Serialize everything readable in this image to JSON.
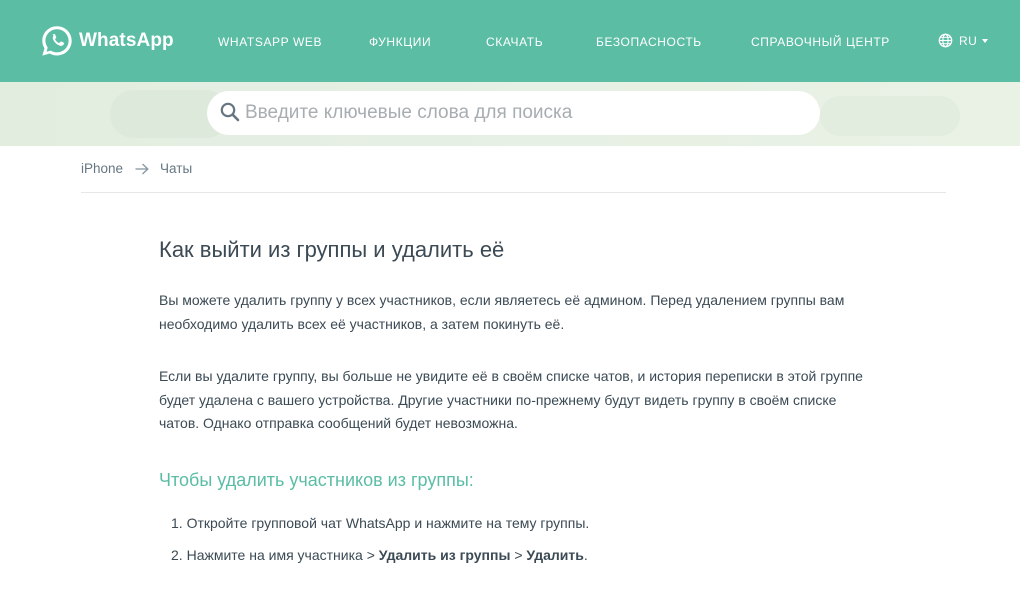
{
  "header": {
    "logo_text": "WhatsApp",
    "nav": [
      {
        "label": "WHATSAPP WEB"
      },
      {
        "label": "ФУНКЦИИ"
      },
      {
        "label": "СКАЧАТЬ"
      },
      {
        "label": "БЕЗОПАСНОСТЬ"
      },
      {
        "label": "СПРАВОЧНЫЙ ЦЕНТР"
      }
    ],
    "language": "RU",
    "icons": [
      "whatsapp-logo-icon",
      "globe-icon",
      "caret-down-icon"
    ]
  },
  "search": {
    "placeholder": "Введите ключевые слова для поиска",
    "icon": "search-icon"
  },
  "breadcrumb": {
    "items": [
      {
        "label": "iPhone"
      },
      {
        "label": "Чаты"
      }
    ],
    "separator_icon": "arrow-right-icon"
  },
  "article": {
    "title": "Как выйти из группы и удалить её",
    "paragraph1": "Вы можете удалить группу у всех участников, если являетесь её админом. Перед удалением группы вам необходимо удалить всех её участников, а затем покинуть её.",
    "paragraph2": "Если вы удалите группу, вы больше не увидите её в своём списке чатов, и история переписки в этой группе будет удалена с вашего устройства. Другие участники по-прежнему будут видеть группу в своём списке чатов. Однако отправка сообщений будет невозможна.",
    "subheading": "Чтобы удалить участников из группы:",
    "steps": [
      {
        "num": "1.",
        "text": "Откройте групповой чат WhatsApp и нажмите на тему группы."
      },
      {
        "num": "2.",
        "text_before": "Нажмите на имя участника > ",
        "bold1": "Удалить из группы",
        "middle": " > ",
        "bold2": "Удалить",
        "end": "."
      }
    ]
  },
  "colors": {
    "brand": "#5bbda4",
    "search_band": "#e6efe3",
    "text": "#3b4a54",
    "muted": "#667781"
  }
}
